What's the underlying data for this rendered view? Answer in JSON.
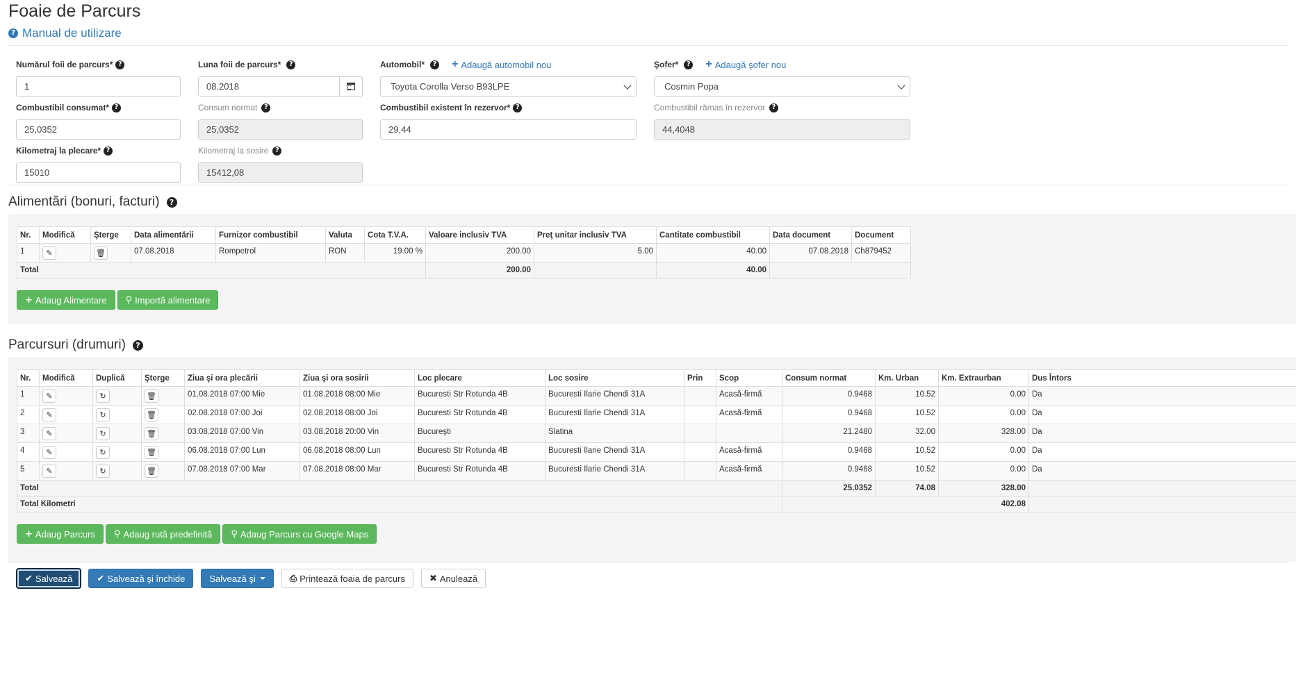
{
  "header": {
    "title": "Foaie de Parcurs",
    "manual_label": "Manual de utilizare"
  },
  "form": {
    "numar_label": "Numărul foii de parcurs*",
    "numar_value": "1",
    "luna_label": "Luna foii de parcurs*",
    "luna_value": "08.2018",
    "auto_label": "Automobil*",
    "auto_add_label": "Adaugă automobil nou",
    "auto_value": "Toyota Corolla Verso B93LPE",
    "sofer_label": "Şofer*",
    "sofer_add_label": "Adaugă şofer nou",
    "sofer_value": "Cosmin Popa",
    "comb_consumat_label": "Combustibil consumat*",
    "comb_consumat_value": "25,0352",
    "consum_normat_label": "Consum normat",
    "consum_normat_value": "25,0352",
    "comb_existent_label": "Combustibil existent în rezervor*",
    "comb_existent_value": "29,44",
    "comb_ramas_label": "Combustibil rămas în rezervor",
    "comb_ramas_value": "44,4048",
    "km_plecare_label": "Kilometraj la plecare*",
    "km_plecare_value": "15010",
    "km_sosire_label": "Kilometraj la sosire",
    "km_sosire_value": "15412,08"
  },
  "alimentari": {
    "title": "Alimentări (bonuri, facturi)",
    "headers": [
      "Nr.",
      "Modifică",
      "Şterge",
      "Data alimentării",
      "Furnizor combustibil",
      "Valuta",
      "Cota T.V.A.",
      "Valoare inclusiv TVA",
      "Preţ unitar inclusiv TVA",
      "Cantitate combustibil",
      "Data document",
      "Document"
    ],
    "rows": [
      {
        "nr": "1",
        "data": "07.08.2018",
        "furnizor": "Rompetrol",
        "valuta": "RON",
        "cota": "19.00 %",
        "valoare": "200.00",
        "pret": "5.00",
        "cantitate": "40.00",
        "data_doc": "07.08.2018",
        "document": "Ch879452"
      }
    ],
    "total_label": "Total",
    "total_valoare": "200.00",
    "total_cantitate": "40.00",
    "btn_adaug": "Adaug Alimentare",
    "btn_importa": "Importă alimentare"
  },
  "parcursuri": {
    "title": "Parcursuri (drumuri)",
    "headers": [
      "Nr.",
      "Modifică",
      "Duplică",
      "Şterge",
      "Ziua şi ora plecării",
      "Ziua şi ora sosirii",
      "Loc plecare",
      "Loc sosire",
      "Prin",
      "Scop",
      "Consum normat",
      "Km. Urban",
      "Km. Extraurban",
      "Dus Întors"
    ],
    "rows": [
      {
        "nr": "1",
        "plecare": "01.08.2018 07:00 Mie",
        "sosire": "01.08.2018 08:00 Mie",
        "loc_plecare": "Bucuresti Str Rotunda 4B",
        "loc_sosire": "Bucuresti Ilarie Chendi 31A",
        "prin": "",
        "scop": "Acasă-firmă",
        "consum": "0.9468",
        "urban": "10.52",
        "extra": "0.00",
        "dus": "Da"
      },
      {
        "nr": "2",
        "plecare": "02.08.2018 07:00 Joi",
        "sosire": "02.08.2018 08:00 Joi",
        "loc_plecare": "Bucuresti Str Rotunda 4B",
        "loc_sosire": "Bucuresti Ilarie Chendi 31A",
        "prin": "",
        "scop": "Acasă-firmă",
        "consum": "0.9468",
        "urban": "10.52",
        "extra": "0.00",
        "dus": "Da"
      },
      {
        "nr": "3",
        "plecare": "03.08.2018 07:00 Vin",
        "sosire": "03.08.2018 20:00 Vin",
        "loc_plecare": "Bucureşti",
        "loc_sosire": "Slatina",
        "prin": "",
        "scop": "",
        "consum": "21.2480",
        "urban": "32.00",
        "extra": "328.00",
        "dus": "Da"
      },
      {
        "nr": "4",
        "plecare": "06.08.2018 07:00 Lun",
        "sosire": "06.08.2018 08:00 Lun",
        "loc_plecare": "Bucuresti Str Rotunda 4B",
        "loc_sosire": "Bucuresti Ilarie Chendi 31A",
        "prin": "",
        "scop": "Acasă-firmă",
        "consum": "0.9468",
        "urban": "10.52",
        "extra": "0.00",
        "dus": "Da"
      },
      {
        "nr": "5",
        "plecare": "07.08.2018 07:00 Mar",
        "sosire": "07.08.2018 08:00 Mar",
        "loc_plecare": "Bucuresti Str Rotunda 4B",
        "loc_sosire": "Bucuresti Ilarie Chendi 31A",
        "prin": "",
        "scop": "Acasă-firmă",
        "consum": "0.9468",
        "urban": "10.52",
        "extra": "0.00",
        "dus": "Da"
      }
    ],
    "total_label": "Total",
    "total_consum": "25.0352",
    "total_urban": "74.08",
    "total_extra": "328.00",
    "total_km_label": "Total Kilometri",
    "total_km": "402.08",
    "btn_adaug": "Adaug Parcurs",
    "btn_ruta": "Adaug rută predefinită",
    "btn_maps": "Adaug Parcurs cu Google Maps"
  },
  "footer": {
    "salveaza": "Salvează",
    "salveaza_inchide": "Salvează şi închide",
    "salveaza_si": "Salvează şi",
    "printeaza": "Printează foaia de parcurs",
    "anuleaza": "Anulează"
  }
}
